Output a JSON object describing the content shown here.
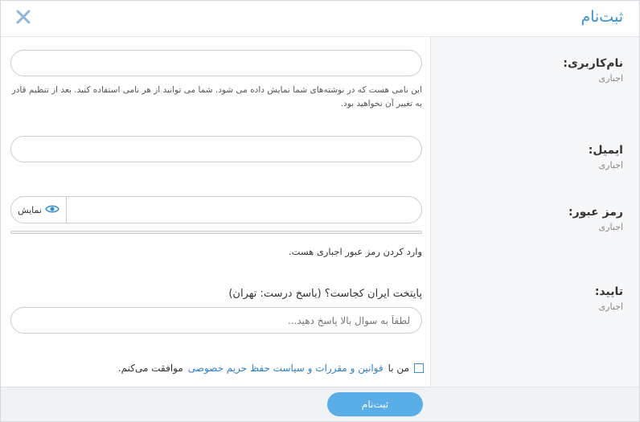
{
  "dialog": {
    "title": "ثبت‌نام",
    "close_icon": "close-icon"
  },
  "username": {
    "label": "نام‌کاربری:",
    "required": "اجباری",
    "value": "",
    "placeholder": "",
    "hint": "این نامی هست که در نوشته‌های شما نمایش داده می شود. شما می توانید از هر نامی استفاده کنید. بعد از تنظیم قادر به تغییر آن نخواهید بود."
  },
  "email": {
    "label": "ایمیل:",
    "required": "اجباری",
    "value": "",
    "placeholder": ""
  },
  "password": {
    "label": "رمز عبور:",
    "required": "اجباری",
    "value": "",
    "show_label": "نمایش",
    "show_icon": "eye-icon",
    "hint": "وارد کردن رمز عبور اجباری هست."
  },
  "captcha": {
    "label": "تایید:",
    "required": "اجباری",
    "question": "پایتخت ایران کجاست؟ (باسخ درست: تهران)",
    "value": "",
    "placeholder": "لطفاً به سوال بالا پاسخ دهید..."
  },
  "agreement": {
    "prefix": "من با",
    "link": "قوانین و مقررات و سیاست حفظ حریم خصوصی",
    "suffix": "موافقت می‌کنم.",
    "checked": false
  },
  "footer": {
    "submit_label": "ثبت‌نام"
  },
  "colors": {
    "accent": "#3a8fd0",
    "button": "#59aee8",
    "link": "#2e7fc4"
  }
}
